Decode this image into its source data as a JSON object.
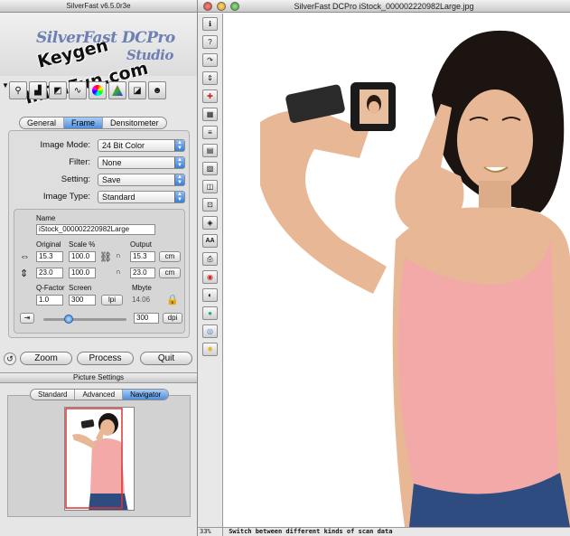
{
  "control_window": {
    "title": "SilverFast v6.5.0r3e",
    "logo_line1": "SilverFast DCPro",
    "logo_line2": "Studio",
    "watermark_line1": "Keygen",
    "watermark_line2": "InDaFun.com",
    "tools": [
      "zoom-tool-icon",
      "histogram-icon",
      "gradation-icon",
      "curve-icon",
      "color-wheel-icon",
      "selective-color-icon",
      "sharpen-icon",
      "portrait-icon"
    ],
    "tabs": [
      {
        "label": "General",
        "active": false
      },
      {
        "label": "Frame",
        "active": true
      },
      {
        "label": "Densitometer",
        "active": false
      }
    ],
    "settings": {
      "image_mode_label": "Image Mode:",
      "image_mode_value": "24 Bit Color",
      "filter_label": "Filter:",
      "filter_value": "None",
      "setting_label": "Setting:",
      "setting_value": "Save",
      "image_type_label": "Image Type:",
      "image_type_value": "Standard"
    },
    "frame": {
      "name_label": "Name",
      "name_value": "iStock_000002220982Large",
      "original_label": "Original",
      "scale_label": "Scale %",
      "output_label": "Output",
      "width_original": "15.3",
      "width_scale": "100.0",
      "width_output": "15.3",
      "width_unit": "cm",
      "height_original": "23.0",
      "height_scale": "100.0",
      "height_output": "23.0",
      "height_unit": "cm",
      "qfactor_label": "Q-Factor",
      "screen_label": "Screen",
      "mbyte_label": "Mbyte",
      "qfactor_value": "1.0",
      "screen_value": "300",
      "screen_unit": "lpi",
      "mbyte_value": "14.06",
      "resolution_value": "300",
      "resolution_unit": "dpi",
      "resolution_slider_fraction": 0.3
    },
    "buttons": {
      "zoom": "Zoom",
      "process": "Process",
      "quit": "Quit"
    },
    "picture_settings": {
      "heading": "Picture Settings",
      "tabs": [
        {
          "label": "Standard",
          "active": false
        },
        {
          "label": "Advanced",
          "active": false
        },
        {
          "label": "Navigator",
          "active": true
        }
      ]
    }
  },
  "preview_window": {
    "title": "SilverFast DCPro iStock_000002220982Large.jpg",
    "zoom_level": "33%",
    "status_text": "Switch between different kinds of scan data",
    "vertical_tools": [
      "info-icon",
      "help-icon",
      "rotate-icon",
      "flip-icon",
      "mirror-icon",
      "pattern-icon",
      "levels-icon",
      "grid-icon",
      "channels-icon",
      "compare-icon",
      "densitometer-icon",
      "spectrum-icon",
      "AA",
      "print-icon",
      "vignette-icon",
      "eye-icon",
      "sharpen-badge-icon",
      "loupe-icon",
      "lamp-icon"
    ],
    "colors": {
      "shirt": "#f2a9a8",
      "skin": "#e8b896",
      "jeans": "#2e4c80",
      "hair": "#1b1410"
    }
  }
}
